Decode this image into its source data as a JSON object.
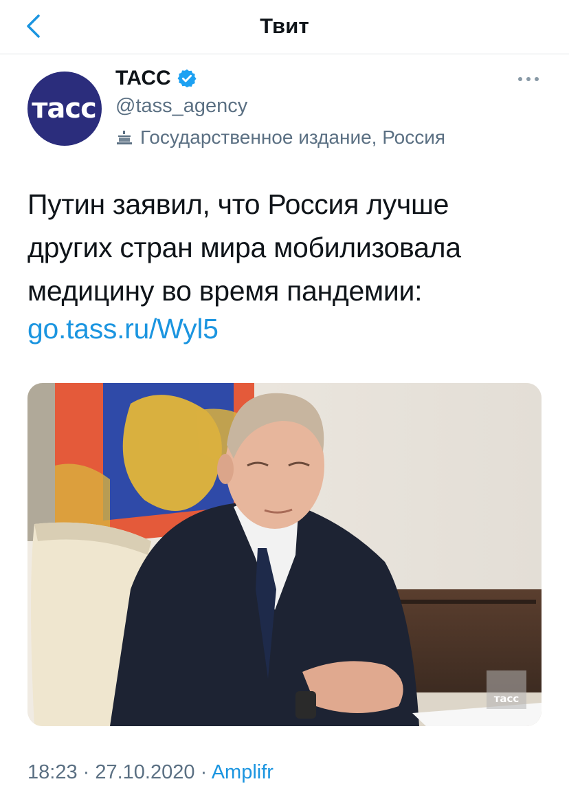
{
  "header": {
    "title": "Твит"
  },
  "author": {
    "name": "ТАСС",
    "handle": "@tass_agency",
    "affiliation": "Государственное издание, Россия",
    "avatar_text": "тасс",
    "avatar_color": "#2b2d7c"
  },
  "tweet": {
    "lines": [
      "Путин заявил, что Россия лучше",
      "других стран мира мобилизовала",
      "медицину во время пандемии:"
    ],
    "link": "go.tass.ru/Wyl5"
  },
  "media": {
    "watermark": "тасс"
  },
  "meta": {
    "time": "18:23",
    "separator1": " · ",
    "date": "27.10.2020",
    "separator2": " · ",
    "source": "Amplifr"
  },
  "colors": {
    "link": "#1b95e0",
    "secondary_text": "#5b7083",
    "verified": "#1da1f2",
    "divider": "#e1e4e6"
  },
  "icons": {
    "back": "chevron-left-icon",
    "verified": "verified-badge-icon",
    "government": "government-building-icon",
    "more": "more-horizontal-icon"
  }
}
